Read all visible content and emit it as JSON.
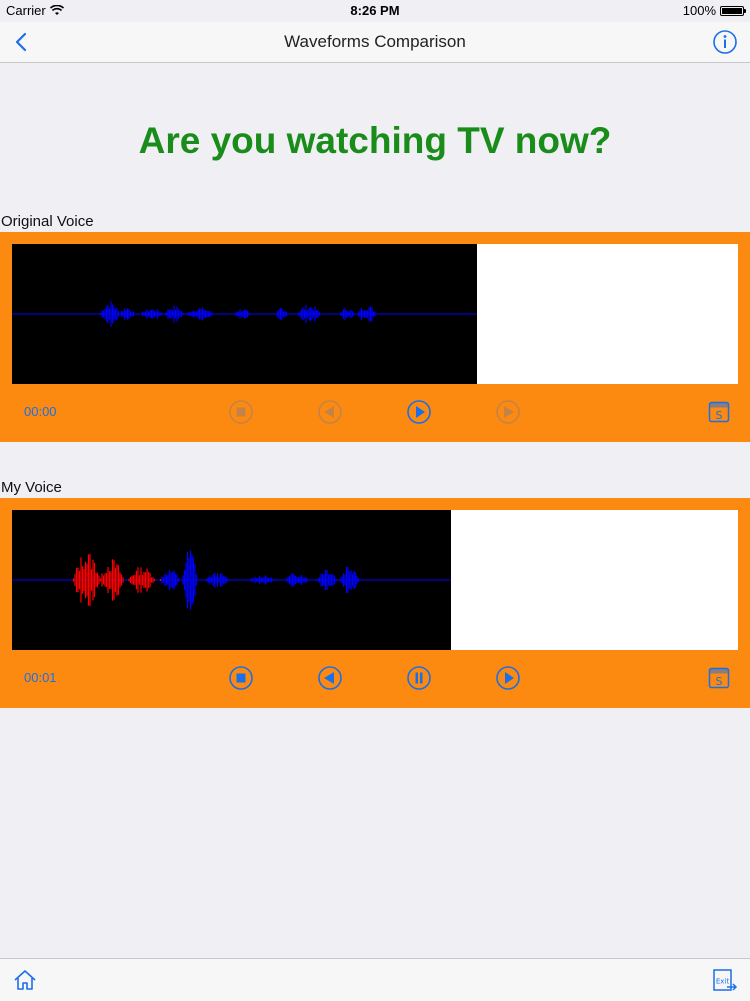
{
  "status_bar": {
    "carrier": "Carrier",
    "time": "8:26 PM",
    "battery": "100%"
  },
  "nav": {
    "title": "Waveforms Comparison",
    "back_icon": "chevron-left-icon",
    "info_icon": "info-icon"
  },
  "prompt": "Are you watching TV now?",
  "original": {
    "label": "Original Voice",
    "time": "00:00",
    "recorded_fraction": 0.64,
    "played_fraction": 0,
    "controls": [
      "stop",
      "rewind",
      "play",
      "forward"
    ],
    "enabled": [
      false,
      false,
      true,
      false
    ]
  },
  "mine": {
    "label": "My Voice",
    "time": "00:01",
    "recorded_fraction": 0.605,
    "played_fraction": 0.34,
    "controls": [
      "stop",
      "rewind",
      "pause",
      "play"
    ],
    "enabled": [
      true,
      true,
      true,
      true
    ]
  },
  "tab_bar": {
    "home_icon": "home-icon",
    "exit_icon": "exit-icon",
    "exit_label": "Exit"
  },
  "colors": {
    "accent": "#1b6fe8",
    "panel": "#fd8a10",
    "prompt": "#1a8c1a",
    "wave_unplayed": "#0000ff",
    "wave_played": "#ff0000"
  }
}
